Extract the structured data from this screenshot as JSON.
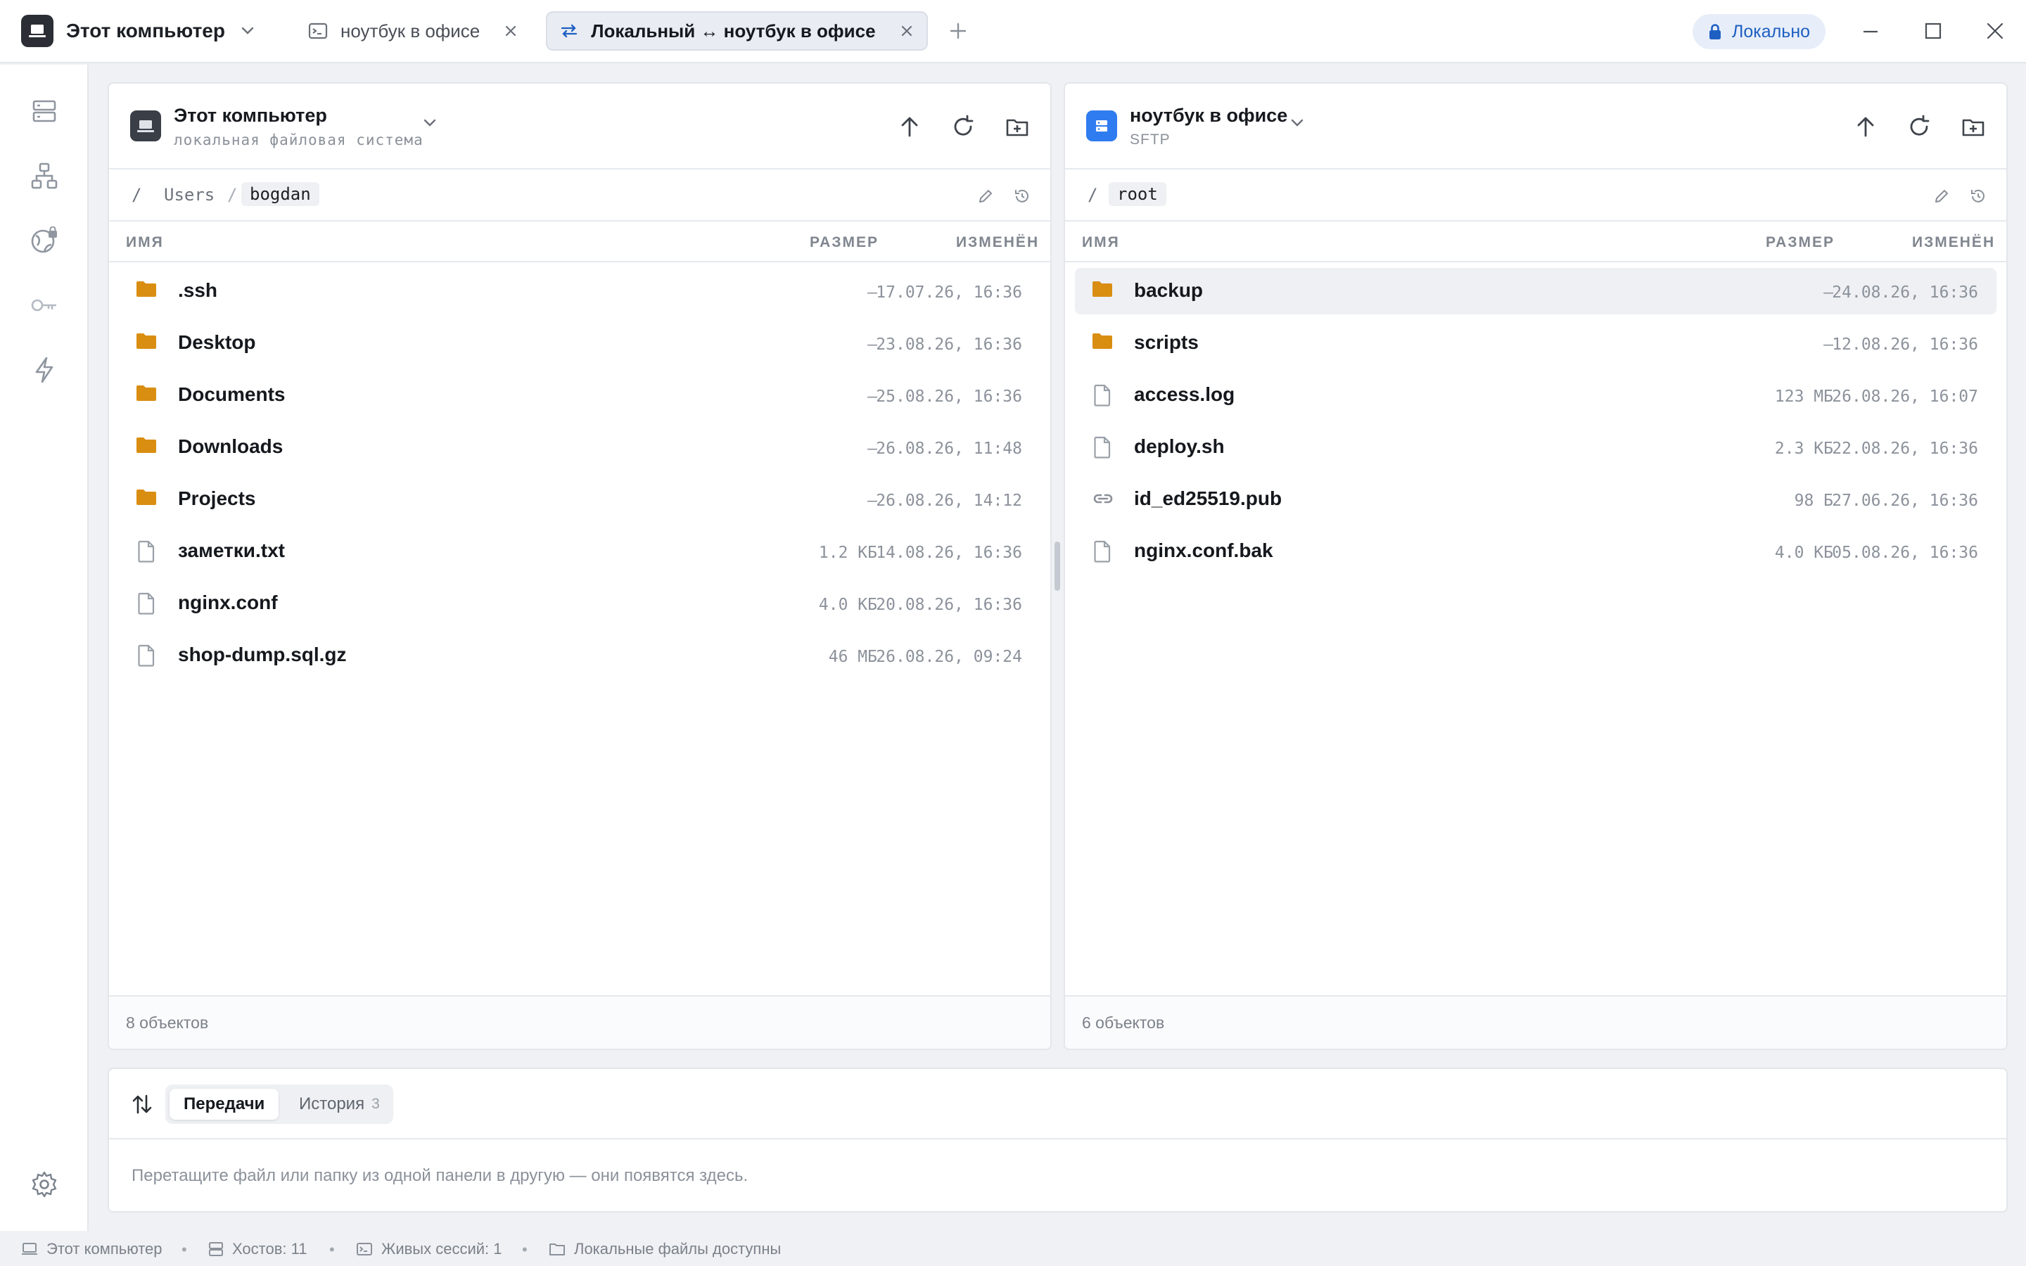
{
  "app": {
    "title": "Этот компьютер",
    "tabs": [
      {
        "label": "ноутбук в офисе",
        "icon": "terminal-icon",
        "active": false
      },
      {
        "label": "Локальный ↔ ноутбук в офисе",
        "icon": "transfer-arrows-icon",
        "active": true
      }
    ],
    "badge": "Локально"
  },
  "rail": {
    "items": [
      "hosts-icon",
      "network-icon",
      "globe-lock-icon",
      "key-icon",
      "snippets-bolt-icon"
    ],
    "bottom": "settings-gear-icon"
  },
  "left_pane": {
    "source_name": "Этот компьютер",
    "source_sub": "локальная файловая система",
    "path": [
      "/",
      "Users",
      "/",
      "bogdan"
    ],
    "columns": {
      "name": "ИМЯ",
      "size": "РАЗМЕР",
      "modified": "ИЗМЕНЁН"
    },
    "files": [
      {
        "name": ".ssh",
        "type": "folder",
        "size": "—",
        "modified": "17.07.26, 16:36"
      },
      {
        "name": "Desktop",
        "type": "folder",
        "size": "—",
        "modified": "23.08.26, 16:36"
      },
      {
        "name": "Documents",
        "type": "folder",
        "size": "—",
        "modified": "25.08.26, 16:36"
      },
      {
        "name": "Downloads",
        "type": "folder",
        "size": "—",
        "modified": "26.08.26, 11:48"
      },
      {
        "name": "Projects",
        "type": "folder",
        "size": "—",
        "modified": "26.08.26, 14:12"
      },
      {
        "name": "заметки.txt",
        "type": "file",
        "size": "1.2 КБ",
        "modified": "14.08.26, 16:36"
      },
      {
        "name": "nginx.conf",
        "type": "file",
        "size": "4.0 КБ",
        "modified": "20.08.26, 16:36"
      },
      {
        "name": "shop-dump.sql.gz",
        "type": "file",
        "size": "46 МБ",
        "modified": "26.08.26, 09:24"
      }
    ],
    "footer": "8 объектов"
  },
  "right_pane": {
    "source_name": "ноутбук в офисе",
    "source_sub": "SFTP",
    "path": [
      "/",
      "root"
    ],
    "columns": {
      "name": "ИМЯ",
      "size": "РАЗМЕР",
      "modified": "ИЗМЕНЁН"
    },
    "files": [
      {
        "name": "backup",
        "type": "folder",
        "size": "—",
        "modified": "24.08.26, 16:36",
        "selected": true
      },
      {
        "name": "scripts",
        "type": "folder",
        "size": "—",
        "modified": "12.08.26, 16:36"
      },
      {
        "name": "access.log",
        "type": "file",
        "size": "123 МБ",
        "modified": "26.08.26, 16:07"
      },
      {
        "name": "deploy.sh",
        "type": "file",
        "size": "2.3 КБ",
        "modified": "22.08.26, 16:36"
      },
      {
        "name": "id_ed25519.pub",
        "type": "link",
        "size": "98 Б",
        "modified": "27.06.26, 16:36"
      },
      {
        "name": "nginx.conf.bak",
        "type": "file",
        "size": "4.0 КБ",
        "modified": "05.08.26, 16:36"
      }
    ],
    "footer": "6 объектов"
  },
  "transfers": {
    "tab_transfers": "Передачи",
    "tab_history": "История",
    "history_count": "3",
    "empty_text": "Перетащите файл или папку из одной панели в другую — они появятся здесь."
  },
  "statusbar": {
    "computer": "Этот компьютер",
    "hosts": "Хостов: 11",
    "sessions": "Живых сессий: 1",
    "local_files": "Локальные файлы доступны"
  },
  "colors": {
    "accent": "#1e5fc2",
    "folder": "#d98e12",
    "remote_icon": "#2f7cf0"
  }
}
